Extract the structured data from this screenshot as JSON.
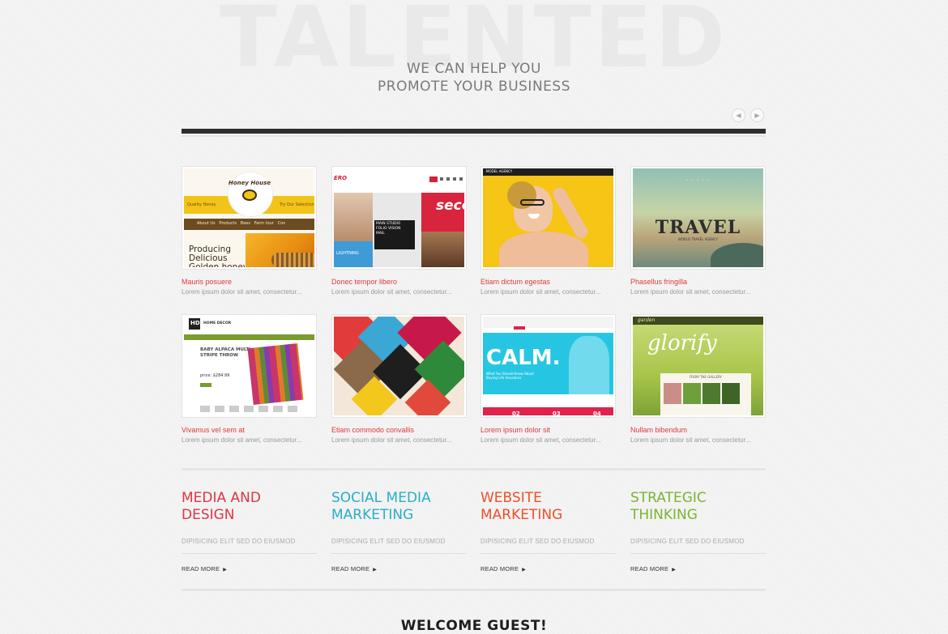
{
  "hero": {
    "background_word": "TALENTED",
    "line1": "WE CAN HELP YOU",
    "line2": "PROMOTE YOUR BUSINESS",
    "prev_icon": "chevron-left-icon",
    "next_icon": "chevron-right-icon",
    "prev_glyph": "◀",
    "next_glyph": "▶"
  },
  "portfolio": {
    "items": [
      {
        "title": "Mauris posuere",
        "desc": "Lorem ipsum dolor sit amet, consectetur...",
        "thumb": {
          "brand": "Honey House",
          "tag1": "Quality Honey",
          "tag2": "Try Our Selection",
          "nav": "About Us   Products   Bees   Farm tour   Con",
          "headline": "Producing\nDelicious\nGolden honey"
        }
      },
      {
        "title": "Donec tempor libero",
        "desc": "Lorem ipsum dolor sit amet, consectetur...",
        "thumb": {
          "logo": "ERO",
          "big": "seco",
          "words": [
            "MAIN",
            "STUDIO",
            "FOLIO",
            "VISION",
            "MAIL"
          ],
          "caption": "LIGHTNING"
        }
      },
      {
        "title": "Etiam dictum egestas",
        "desc": "Lorem ipsum dolor sit amet, consectetur...",
        "thumb": {
          "brand": "MODEL AGENCY"
        }
      },
      {
        "title": "Phasellus fringilla",
        "desc": "Lorem ipsum dolor sit amet, consectetur...",
        "thumb": {
          "word": "TRAVEL",
          "stars": "• • • • •",
          "sub": "WORLD TRAVEL AGENCY"
        }
      },
      {
        "title": "Vivamus vel sem at",
        "desc": "Lorem ipsum dolor sit amet, consectetur...",
        "thumb": {
          "logo": "HD",
          "brand": "HOME DECOR",
          "headline": "BABY ALPACA MULTI-\nSTRIPE THROW",
          "price": "price: $284.99"
        }
      },
      {
        "title": "Etiam commodo convallis",
        "desc": "Lorem ipsum dolor sit amet, consectetur...",
        "thumb": {}
      },
      {
        "title": "Lorem ipsum dolor sit",
        "desc": "Lorem ipsum dolor sit amet, consectetur...",
        "thumb": {
          "word": "CALM.",
          "sub": "What You Should Know About\nBuying Life Insurance",
          "nums": [
            "02",
            "03",
            "04"
          ]
        }
      },
      {
        "title": "Nullam bibendum",
        "desc": "Lorem ipsum dolor sit amet, consectetur...",
        "thumb": {
          "logo": "garden",
          "word": "glorify",
          "sub": "FROM THE GALLERY"
        }
      }
    ]
  },
  "services": [
    {
      "title": "MEDIA AND\nDESIGN",
      "color": "#e03347",
      "sub": "DIPISICING ELIT SED DO EIUSMOD",
      "more": "READ MORE"
    },
    {
      "title": "SOCIAL MEDIA\nMARKETING",
      "color": "#27aec9",
      "sub": "DIPISICING ELIT SED DO EIUSMOD",
      "more": "READ MORE"
    },
    {
      "title": "WEBSITE\nMARKETING",
      "color": "#ee4f2a",
      "sub": "DIPISICING ELIT SED DO EIUSMOD",
      "more": "READ MORE"
    },
    {
      "title": "STRATEGIC\nTHINKING",
      "color": "#79b52e",
      "sub": "DIPISICING ELIT SED DO EIUSMOD",
      "more": "READ MORE"
    }
  ],
  "welcome": "WELCOME GUEST!",
  "colors": {
    "link_red": "#e03a3a",
    "dark_bar": "#2d2d2d"
  }
}
